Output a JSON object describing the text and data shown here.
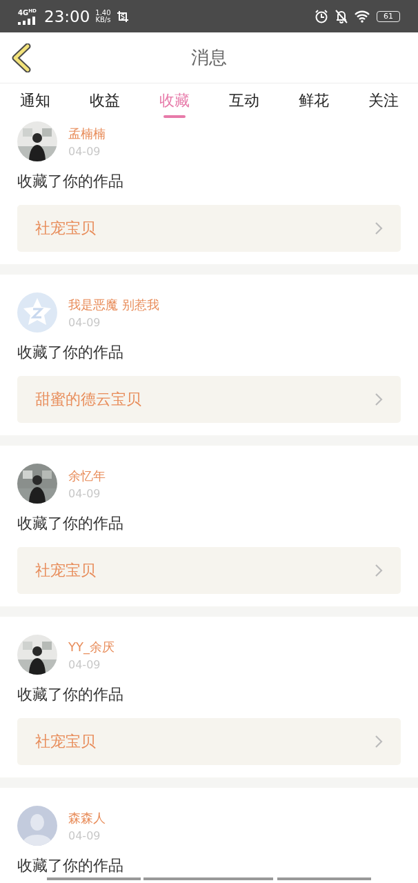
{
  "status_bar": {
    "network": "4G",
    "network_badge": "HD",
    "time": "23:00",
    "speed": "1.40",
    "speed_unit": "KB/s",
    "battery": "61"
  },
  "header": {
    "title": "消息"
  },
  "tabs": [
    {
      "label": "通知",
      "selected": false
    },
    {
      "label": "收益",
      "selected": false
    },
    {
      "label": "收藏",
      "selected": true
    },
    {
      "label": "互动",
      "selected": false
    },
    {
      "label": "鲜花",
      "selected": false
    },
    {
      "label": "关注",
      "selected": false
    }
  ],
  "messages": [
    {
      "name": "孟楠楠",
      "date": "04-09",
      "text": "收藏了你的作品",
      "work": "社宠宝贝"
    },
    {
      "kind": "star",
      "name": "我是恶魔 别惹我",
      "date": "04-09",
      "text": "收藏了你的作品",
      "work": "甜蜜的德云宝贝"
    },
    {
      "name": "余忆年",
      "date": "04-09",
      "text": "收藏了你的作品",
      "work": "社宠宝贝"
    },
    {
      "name": "YY_余厌",
      "date": "04-09",
      "text": "收藏了你的作品",
      "work": "社宠宝贝"
    },
    {
      "kind": "silhouette",
      "name": "森森人",
      "date": "04-09",
      "text": "收藏了你的作品"
    }
  ]
}
